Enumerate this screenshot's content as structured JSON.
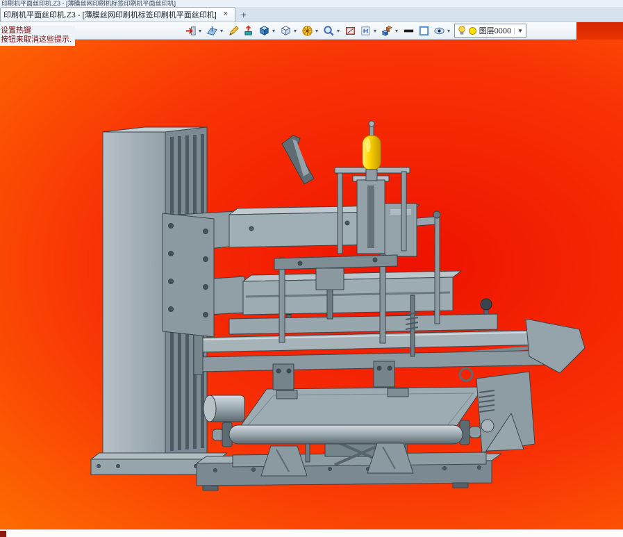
{
  "titlebar": {
    "clipped_title": "印刷机平面丝印机.Z3 - [薄膜丝网印刷机标签印刷机平面丝印机]"
  },
  "tabbar": {
    "tab_title": "印刷机平面丝印机.Z3 - [薄膜丝网印刷机标签印刷机平面丝印机]",
    "close_glyph": "×",
    "new_tab_glyph": "+"
  },
  "toolbar": {
    "dropdown_glyph": "▾",
    "icons": [
      "finish-exit-icon",
      "datum-plane-icon",
      "sketch-pencil-icon",
      "extrude-icon",
      "solid-cube-icon",
      "wireframe-cube-icon",
      "pattern-wheel-icon",
      "zoom-magnifier-icon",
      "section-frame-icon",
      "reference-grid-icon",
      "assembly-cubes-icon",
      "line-width-icon",
      "color-swatch-icon",
      "visibility-eye-icon"
    ],
    "layer_control": {
      "bulb_icon": "layer-visibility-bulb-icon",
      "color_icon": "layer-color-dot-icon",
      "label": "图层0000",
      "dropdown_glyph": "▼"
    }
  },
  "hint": {
    "line1": "设置热键",
    "line2": "按钮来取消这些提示."
  },
  "viewport_colors": {
    "bg_center": "#ee1200",
    "bg_mid": "#f93305",
    "bg_edge": "#ff8a00",
    "machine_gray": "#97a5ad",
    "machine_light": "#c3ced3",
    "machine_dark": "#6e7c84",
    "knob_yellow": "#ffd800"
  }
}
